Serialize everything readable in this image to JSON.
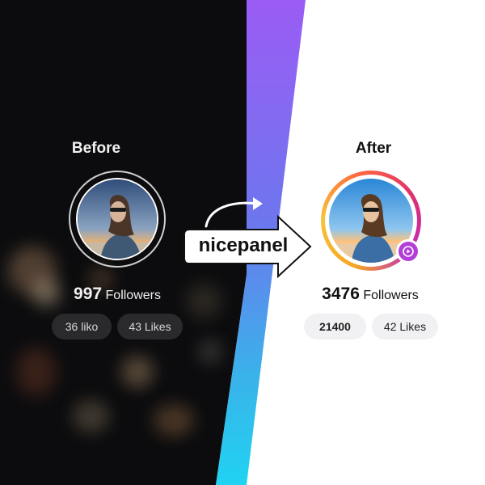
{
  "before": {
    "title": "Before",
    "followers_count": "997",
    "followers_label": "Followers",
    "stats": [
      "36 liko",
      "43 Likes"
    ]
  },
  "after": {
    "title": "After",
    "followers_count": "3476",
    "followers_label": "Followers",
    "stats": [
      "21400",
      "42 Likes"
    ]
  },
  "brand": {
    "name": "nicepanel"
  },
  "colors": {
    "dark_bg": "#0c0c0e",
    "gradient_top": "#9b5cf5",
    "gradient_bottom": "#20d3f2",
    "story_ring": "#e1306c",
    "badge": "#b33fd8"
  },
  "icons": {
    "story_badge": "play-icon",
    "arrow": "arrow-right-icon",
    "curve": "curved-arrow-icon"
  }
}
